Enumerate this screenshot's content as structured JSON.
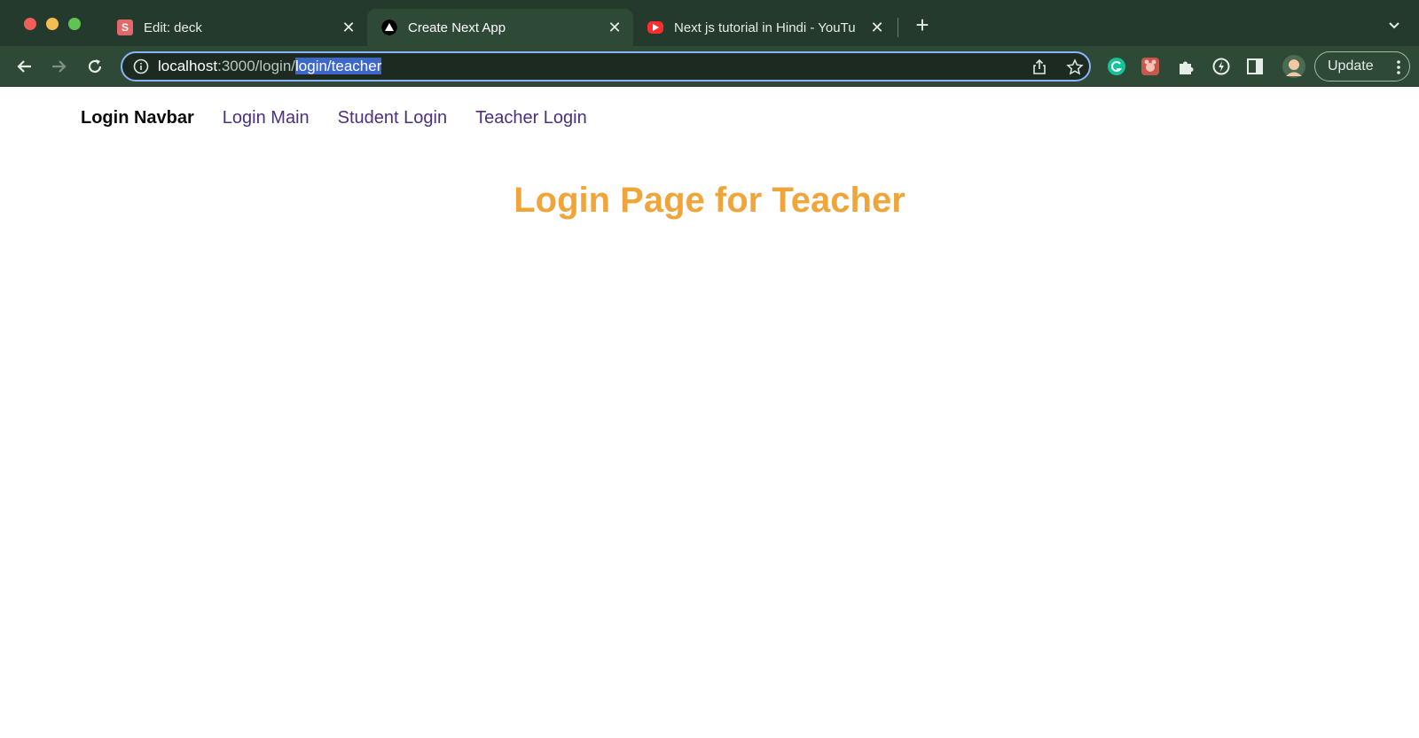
{
  "browser": {
    "tabs": [
      {
        "title": "Edit: deck",
        "favicon": "s-icon",
        "active": false
      },
      {
        "title": "Create Next App",
        "favicon": "nextjs-icon",
        "active": true
      },
      {
        "title": "Next js tutorial in Hindi - YouTu",
        "favicon": "youtube-icon",
        "active": false
      }
    ],
    "url": {
      "host": "localhost",
      "path": ":3000/login/",
      "selected": "login/teacher"
    },
    "update_label": "Update",
    "colors": {
      "tabbar": "#233a2c",
      "toolbar": "#2e4a37",
      "omnibox_focus": "#8ab4f8",
      "url_selection": "#3d68c9"
    }
  },
  "page": {
    "navbar": {
      "brand": "Login Navbar",
      "links": [
        "Login Main",
        "Student Login",
        "Teacher Login"
      ]
    },
    "heading": "Login Page for Teacher",
    "colors": {
      "heading": "#f0a53a",
      "link": "#4b2f80"
    }
  }
}
